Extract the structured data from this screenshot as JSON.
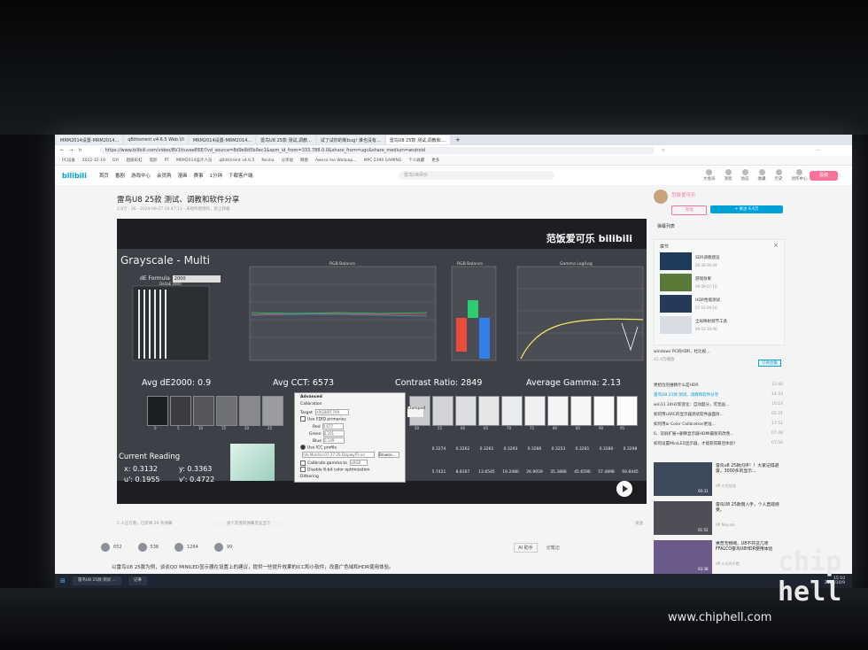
{
  "browser": {
    "tabs": [
      "MRM2014设置-MRM2014...",
      "qBittorrent v4.6.5 Web UI",
      "MRM2014设置-MRM2014...",
      "雷鸟U8 25款 测试,调教...",
      "试了试你的新bug! 谁也没有...",
      "雷鸟U8 25款 测试,调教和...."
    ],
    "url": "https://www.bilibili.com/video/BV1ttuveeE6E/?vd_source=8d9e8d5b0ec1&spm_id_from=333.788.0.0&share_from=ugc&share_medium=android",
    "bookmarks": [
      "PC设备",
      "2011-12-19",
      "DIY",
      "超级彩虹",
      "电影",
      "PT",
      "MRM2014设计人员",
      "qBittorrent v4.6.5",
      "Nvidia",
      "分享站",
      "网盘",
      "Aweso me Wallpap...",
      "MPC 2390 GAMING",
      "个人收藏",
      "更多"
    ]
  },
  "site": {
    "logo": "bilibili",
    "nav": [
      "首页",
      "番剧",
      "游戏中心",
      "会员购",
      "漫画",
      "赛事",
      "1分钟",
      "下载客户端"
    ],
    "search_placeholder": "雷鸟U8评价",
    "header_icons": [
      "大会员",
      "消息",
      "动态",
      "收藏",
      "历史",
      "创作中心"
    ],
    "upload": "投稿"
  },
  "video": {
    "title": "雷鸟U8 25款 测试、调教和软件分享",
    "meta": "2.8万  ·  26  ·  2024-09-27 18:47:11  ·  未经作者授权，禁止转载",
    "watermark": "范饭爱可乐 bilibili",
    "calman": {
      "title": "Grayscale - Multi",
      "de_formula_label": "dE Formula",
      "de_formula_value": "2000",
      "delta_label": "DeltaE 2000",
      "rgb_balance": "RGB Balance",
      "rgb_balance2": "RGB Balance",
      "gamma_loglog": "Gamma Log/Log",
      "avg_de": "Avg dE2000: 0.9",
      "avg_cct": "Avg CCT: 6573",
      "contrast": "Contrast Ratio: 2849",
      "avg_gamma": "Average Gamma: 2.13",
      "current_reading": "Current Reading",
      "x": "x: 0.3132",
      "y": "y: 0.3363",
      "u": "u': 0.1955",
      "v": "v': 0.4722",
      "swatch_labels": [
        "0",
        "5",
        "10",
        "15",
        "20",
        "25",
        "50",
        "55",
        "60",
        "65",
        "70",
        "75",
        "80",
        "85",
        "90",
        "95",
        "100"
      ],
      "dialog": {
        "title": "Advanced",
        "calibration": "Calibration",
        "target": "Target",
        "target_value": "sRGB/BT.709",
        "use_edid": "Use EDID primaries",
        "red": "Red",
        "green": "Green",
        "blue": "Blue",
        "red_x": "0.677",
        "green_x": "0.201",
        "blue_x": "0.149",
        "use_icc": "Use ICC profile",
        "icc_path": "\\\\AI Monitor-07-27-35-DisplayP3.icc",
        "browse": "Browse...",
        "calibrate_gamma": "Calibrate gamma to",
        "gamma_value": "sRGB",
        "disable_8bit": "Disable 8-bit color optimization",
        "dithering": "Dithering",
        "clamped": "Clamped"
      },
      "table_rows": [
        [
          "0.3274",
          "0.3262",
          "0.3261",
          "0.3293",
          "0.3286",
          "0.3253",
          "0.3281",
          "0.3280",
          "0.3298"
        ],
        [
          "5.7421",
          "8.8167",
          "13.6545",
          "19.2480",
          "26.9059",
          "35.3866",
          "45.6596",
          "57.4898",
          "69.8445"
        ]
      ]
    },
    "danmu": "5 人正在看，已装填 26 条弹幕",
    "danmu_placeholder": "发个友善的弹幕见证当下",
    "danmu_send": "发送",
    "actions": [
      {
        "icon": "like-icon",
        "count": "652"
      },
      {
        "icon": "coin-icon",
        "count": "538"
      },
      {
        "icon": "star-icon",
        "count": "1264"
      },
      {
        "icon": "share-icon",
        "count": "99"
      }
    ],
    "ai_assistant": "AI 助手",
    "notes": "记笔记",
    "description": "以雷鸟U8 25款为例，谈谈QD MINILED显示器在设置上的建议，提供一些提升效果的ICC和小软件，改善广色域和HDR使用体验。"
  },
  "sidebar": {
    "up_name": "范饭爱可乐",
    "charge": "充电",
    "follow": "+ 关注 6.6万",
    "playlist": "弹幕列表",
    "chapters_title": "章节",
    "chapters": [
      {
        "label": "SDR调教建议",
        "time": "00:30-06:09"
      },
      {
        "label": "游戏效果",
        "time": "06:09-07:16"
      },
      {
        "label": "HDR性能测试",
        "time": "07:16-09:16"
      },
      {
        "label": "全局映射调节工具",
        "time": "09:16-10:46"
      }
    ],
    "promo": "windows PC的HDR、杜比视...",
    "promo_count": "42.4万播放",
    "promo_btn": "订阅合集",
    "recs": [
      {
        "label": "更招位的维精什么是HDR",
        "time": "13:40"
      },
      {
        "label": "雷鸟U8 25款 测试、调教和软件分享",
        "time": "14:33"
      },
      {
        "label": "win11 24H2新变化：自动超分，可皇画...",
        "time": "10:14"
      },
      {
        "label": "如何用sARC的显示器测试软件画面效...",
        "time": "02:21"
      },
      {
        "label": "如何用ai Color Calibration更准...",
        "time": "17:51"
      },
      {
        "label": "6、双屏扩展+删降显示器HDMI最新的改善...",
        "time": "07:49"
      },
      {
        "label": "如何设置MiniLED显示器，才能获得最佳体验?",
        "time": "07:56"
      }
    ],
    "videos": [
      {
        "label": "雷鸟u8 25款闪评！！大家记得避雷，3000多的显示...",
        "author": "UP 小白加油",
        "dur": "00:31"
      },
      {
        "label": "雷鸟U8 25款刚入手，个人直观感受。",
        "author": "UP Noyuan",
        "dur": "01:52"
      },
      {
        "label": "惠普无物啊，U8不开这几项FFALCO雷鸟U8HDR使用体验",
        "author": "UP 小光光不错",
        "dur": "03:38"
      }
    ]
  },
  "taskbar": {
    "items": [
      "雷鸟U8 25款 测试 ...",
      "记事"
    ],
    "time": "15:10",
    "date": "2024/10/9"
  },
  "photo_watermark": {
    "logo": "chip hell",
    "url": "www.chiphell.com"
  }
}
